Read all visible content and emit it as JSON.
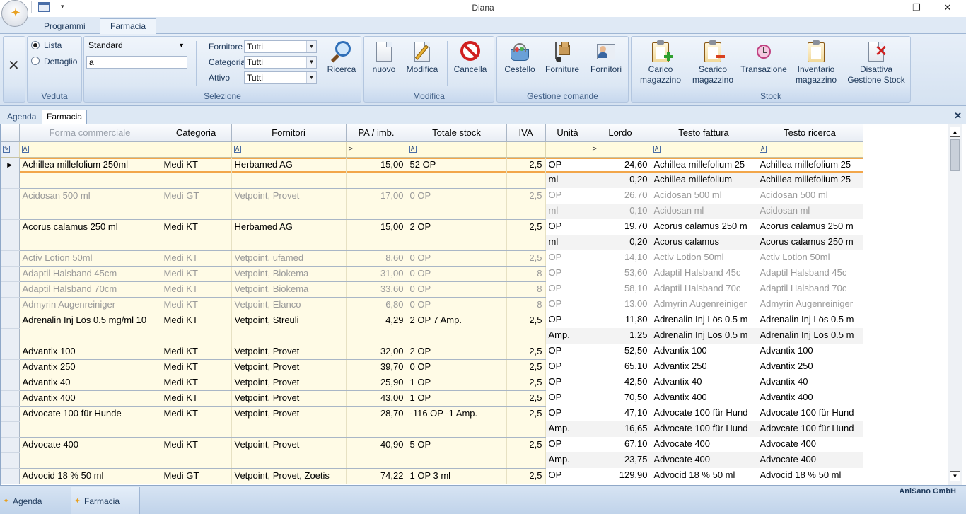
{
  "app_title": "Diana",
  "ribbon_tabs": [
    "Programmi",
    "Farmacia"
  ],
  "veduta": {
    "label": "Veduta",
    "options": [
      "Lista",
      "Dettaglio"
    ],
    "selected": "Lista"
  },
  "selezione": {
    "label": "Selezione",
    "view_combo": "Standard",
    "search_value": "a",
    "fornitore_label": "Fornitore",
    "fornitore_value": "Tutti",
    "categoria_label": "Categoria",
    "categoria_value": "Tutti",
    "attivo_label": "Attivo",
    "attivo_value": "Tutti",
    "ricerca": "Ricerca"
  },
  "modifica": {
    "label": "Modifica",
    "nuovo": "nuovo",
    "modifica": "Modifica",
    "cancella": "Cancella"
  },
  "gestione": {
    "label": "Gestione comande",
    "cestello": "Cestello",
    "forniture": "Forniture",
    "fornitori": "Fornitori"
  },
  "stock": {
    "label": "Stock",
    "carico": "Carico magazzino",
    "scarico": "Scarico magazzino",
    "transazione": "Transazione",
    "inventario": "Inventario magazzino",
    "disattiva": "Disattiva Gestione Stock"
  },
  "doc_tabs": [
    "Agenda",
    "Farmacia"
  ],
  "grid": {
    "headers": [
      "Forma commerciale",
      "Categoria",
      "Fornitori",
      "PA / imb.",
      "Totale stock",
      "IVA",
      "Unità",
      "Lordo",
      "Testo fattura",
      "Testo ricerca"
    ],
    "rows": [
      {
        "name": "Achillea millefolium 250ml",
        "cat": "Medi KT",
        "forn": "Herbamed AG",
        "pa": "15,00",
        "stock": "52 OP",
        "iva": "2,5",
        "active": true,
        "current": true,
        "units": [
          {
            "u": "OP",
            "lordo": "24,60",
            "tf": "Achillea millefolium 25",
            "tr": "Achillea millefolium 25"
          },
          {
            "u": "ml",
            "lordo": "0,20",
            "tf": "Achillea millefolium",
            "tr": "Achillea millefolium 25"
          }
        ]
      },
      {
        "name": "Acidosan 500 ml",
        "cat": "Medi GT",
        "forn": "Vetpoint, Provet",
        "pa": "17,00",
        "stock": "0 OP",
        "iva": "2,5",
        "active": false,
        "units": [
          {
            "u": "OP",
            "lordo": "26,70",
            "tf": "Acidosan 500 ml",
            "tr": "Acidosan 500 ml"
          },
          {
            "u": "ml",
            "lordo": "0,10",
            "tf": "Acidosan ml",
            "tr": "Acidosan ml"
          }
        ]
      },
      {
        "name": "Acorus calamus 250 ml",
        "cat": "Medi KT",
        "forn": "Herbamed AG",
        "pa": "15,00",
        "stock": "2 OP",
        "iva": "2,5",
        "active": true,
        "units": [
          {
            "u": "OP",
            "lordo": "19,70",
            "tf": "Acorus calamus 250 m",
            "tr": "Acorus calamus 250 m"
          },
          {
            "u": "ml",
            "lordo": "0,20",
            "tf": "Acorus calamus",
            "tr": "Acorus calamus 250 m"
          }
        ]
      },
      {
        "name": "Activ Lotion 50ml",
        "cat": "Medi KT",
        "forn": "Vetpoint, ufamed",
        "pa": "8,60",
        "stock": "0 OP",
        "iva": "2,5",
        "active": false,
        "units": [
          {
            "u": "OP",
            "lordo": "14,10",
            "tf": "Activ Lotion 50ml",
            "tr": "Activ Lotion 50ml"
          }
        ]
      },
      {
        "name": "Adaptil Halsband 45cm",
        "cat": "Medi KT",
        "forn": "Vetpoint, Biokema",
        "pa": "31,00",
        "stock": "0 OP",
        "iva": "8",
        "active": false,
        "units": [
          {
            "u": "OP",
            "lordo": "53,60",
            "tf": "Adaptil Halsband 45c",
            "tr": "Adaptil Halsband 45c"
          }
        ]
      },
      {
        "name": "Adaptil Halsband 70cm",
        "cat": "Medi KT",
        "forn": "Vetpoint, Biokema",
        "pa": "33,60",
        "stock": "0 OP",
        "iva": "8",
        "active": false,
        "units": [
          {
            "u": "OP",
            "lordo": "58,10",
            "tf": "Adaptil Halsband 70c",
            "tr": "Adaptil Halsband 70c"
          }
        ]
      },
      {
        "name": "Admyrin Augenreiniger",
        "cat": "Medi KT",
        "forn": "Vetpoint, Elanco",
        "pa": "6,80",
        "stock": "0 OP",
        "iva": "8",
        "active": false,
        "units": [
          {
            "u": "OP",
            "lordo": "13,00",
            "tf": "Admyrin Augenreiniger",
            "tr": "Admyrin Augenreiniger"
          }
        ]
      },
      {
        "name": "Adrenalin Inj Lös 0.5 mg/ml 10",
        "cat": "Medi KT",
        "forn": "Vetpoint, Streuli",
        "pa": "4,29",
        "stock": "2 OP 7 Amp.",
        "iva": "2,5",
        "active": true,
        "units": [
          {
            "u": "OP",
            "lordo": "11,80",
            "tf": "Adrenalin Inj Lös 0.5 m",
            "tr": "Adrenalin Inj Lös 0.5 m"
          },
          {
            "u": "Amp.",
            "lordo": "1,25",
            "tf": "Adrenalin Inj Lös 0.5 m",
            "tr": "Adrenalin Inj Lös 0.5 m"
          }
        ]
      },
      {
        "name": "Advantix 100",
        "cat": "Medi KT",
        "forn": "Vetpoint, Provet",
        "pa": "32,00",
        "stock": "2 OP",
        "iva": "2,5",
        "active": true,
        "units": [
          {
            "u": "OP",
            "lordo": "52,50",
            "tf": "Advantix 100",
            "tr": "Advantix 100"
          }
        ]
      },
      {
        "name": "Advantix 250",
        "cat": "Medi KT",
        "forn": "Vetpoint, Provet",
        "pa": "39,70",
        "stock": "0 OP",
        "iva": "2,5",
        "active": true,
        "units": [
          {
            "u": "OP",
            "lordo": "65,10",
            "tf": "Advantix 250",
            "tr": "Advantix 250"
          }
        ]
      },
      {
        "name": "Advantix 40",
        "cat": "Medi KT",
        "forn": "Vetpoint, Provet",
        "pa": "25,90",
        "stock": "1 OP",
        "iva": "2,5",
        "active": true,
        "units": [
          {
            "u": "OP",
            "lordo": "42,50",
            "tf": "Advantix 40",
            "tr": "Advantix 40"
          }
        ]
      },
      {
        "name": "Advantix 400",
        "cat": "Medi KT",
        "forn": "Vetpoint, Provet",
        "pa": "43,00",
        "stock": "1 OP",
        "iva": "2,5",
        "active": true,
        "units": [
          {
            "u": "OP",
            "lordo": "70,50",
            "tf": "Advantix 400",
            "tr": "Advantix 400"
          }
        ]
      },
      {
        "name": "Advocate 100 für Hunde",
        "cat": "Medi KT",
        "forn": "Vetpoint, Provet",
        "pa": "28,70",
        "stock": "-116 OP -1 Amp.",
        "iva": "2,5",
        "active": true,
        "units": [
          {
            "u": "OP",
            "lordo": "47,10",
            "tf": "Advocate 100 für Hund",
            "tr": "Advocate 100 für Hund"
          },
          {
            "u": "Amp.",
            "lordo": "16,65",
            "tf": "Advocate 100 für Hund",
            "tr": "Adovcate 100 für Hund"
          }
        ]
      },
      {
        "name": "Advocate 400",
        "cat": "Medi KT",
        "forn": "Vetpoint, Provet",
        "pa": "40,90",
        "stock": "5 OP",
        "iva": "2,5",
        "active": true,
        "units": [
          {
            "u": "OP",
            "lordo": "67,10",
            "tf": "Advocate 400",
            "tr": "Advocate 400"
          },
          {
            "u": "Amp.",
            "lordo": "23,75",
            "tf": "Advocate 400",
            "tr": "Advocate 400"
          }
        ]
      },
      {
        "name": "Advocid 18 % 50 ml",
        "cat": "Medi GT",
        "forn": "Vetpoint, Provet, Zoetis",
        "pa": "74,22",
        "stock": "1 OP 3 ml",
        "iva": "2,5",
        "active": true,
        "units": [
          {
            "u": "OP",
            "lordo": "129,90",
            "tf": "Advocid 18 % 50 ml",
            "tr": "Advocid 18 % 50 ml"
          }
        ]
      }
    ]
  },
  "bottom_tabs": [
    "Agenda",
    "Farmacia"
  ],
  "company": "AniSano GmbH"
}
